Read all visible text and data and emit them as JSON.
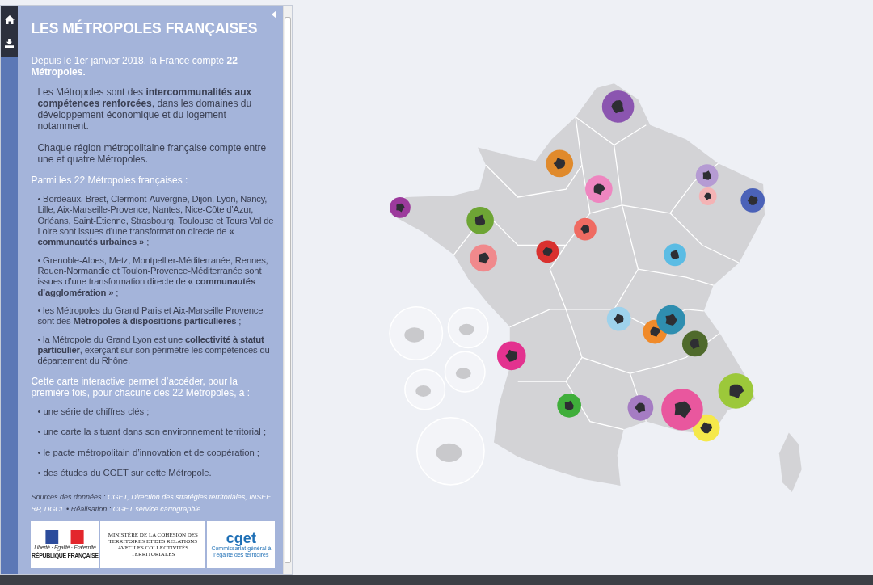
{
  "panel": {
    "title": "LES MÉTROPOLES FRANÇAISES",
    "intro": "Depuis le 1er janvier 2018, la France compte **22 Métropoles.**",
    "paragraphs": [
      "Les Métropoles sont des **intercommunalités aux compétences renforcées**, dans les domaines du développement économique et du logement notamment.",
      "Chaque région métropolitaine française compte entre une et quatre Métropoles."
    ],
    "list_heading": "Parmi les 22 Métropoles françaises :",
    "list_items": [
      "• Bordeaux, Brest, Clermont-Auvergne, Dijon, Lyon, Nancy, Lille, Aix-Marseille-Provence, Nantes, Nice-Côte d’Azur, Orléans, Saint-Étienne, Strasbourg, Toulouse et Tours Val de Loire sont issues d’une transformation directe de **« communautés urbaines »** ;",
      "• Grenoble-Alpes, Metz, Montpellier-Méditerranée, Rennes, Rouen-Normandie et Toulon-Provence-Méditerranée sont issues d’une transformation directe de **« communautés d’agglomération »** ;",
      "• les Métropoles du Grand Paris et Aix-Marseille Provence sont des **Métropoles à dispositions particulières** ;",
      "• la Métropole du Grand Lyon est une **collectivité à statut particulier**, exerçant sur son périmètre les compétences du département du Rhône."
    ],
    "access_heading": "Cette carte interactive permet d’accéder, pour la première fois, pour chacune des 22 Métropoles, à :",
    "access_items": [
      "• une série de chiffres clés ;",
      "• une carte la situant dans son environnement territorial ;",
      "• le pacte métropolitain d’innovation et de coopération ;",
      "• des études du CGET sur cette Métropole."
    ],
    "sources": {
      "label": "Sources des données :",
      "value": "CGET, Direction des stratégies territoriales, INSEE RP, DGCL",
      "credit_label": "• Réalisation :",
      "credit_value": "CGET service cartographie"
    },
    "logos": {
      "republique": [
        "Liberté · Égalité · Fraternité",
        "RÉPUBLIQUE FRANÇAISE"
      ],
      "ministere": "MINISTÈRE DE LA COHÉSION DES TERRITOIRES ET DES RELATIONS AVEC LES COLLECTIVITÉS TERRITORIALES",
      "cget": "cget",
      "cget_caption": "Commissariat général à l’égalité des territoires"
    }
  },
  "map": {
    "markers": [
      {
        "color": "#8b55b0"
      },
      {
        "color": "#e08a2c"
      },
      {
        "color": "#ee86c0"
      },
      {
        "color": "#b59bd3"
      },
      {
        "color": "#f4b3b5"
      },
      {
        "color": "#4b62b8"
      },
      {
        "color": "#9c3a9c"
      },
      {
        "color": "#6ea535"
      },
      {
        "color": "#ef6b62"
      },
      {
        "color": "#d9312f"
      },
      {
        "color": "#f0898c"
      },
      {
        "color": "#5bbce4"
      },
      {
        "color": "#9ed2ec"
      },
      {
        "color": "#f08a2a"
      },
      {
        "color": "#2f8eb0"
      },
      {
        "color": "#4f6a2c"
      },
      {
        "color": "#e3328f"
      },
      {
        "color": "#9cc83a"
      },
      {
        "color": "#3fae3a"
      },
      {
        "color": "#a57cc3"
      },
      {
        "color": "#f5e84a"
      },
      {
        "color": "#e9579e"
      }
    ]
  }
}
